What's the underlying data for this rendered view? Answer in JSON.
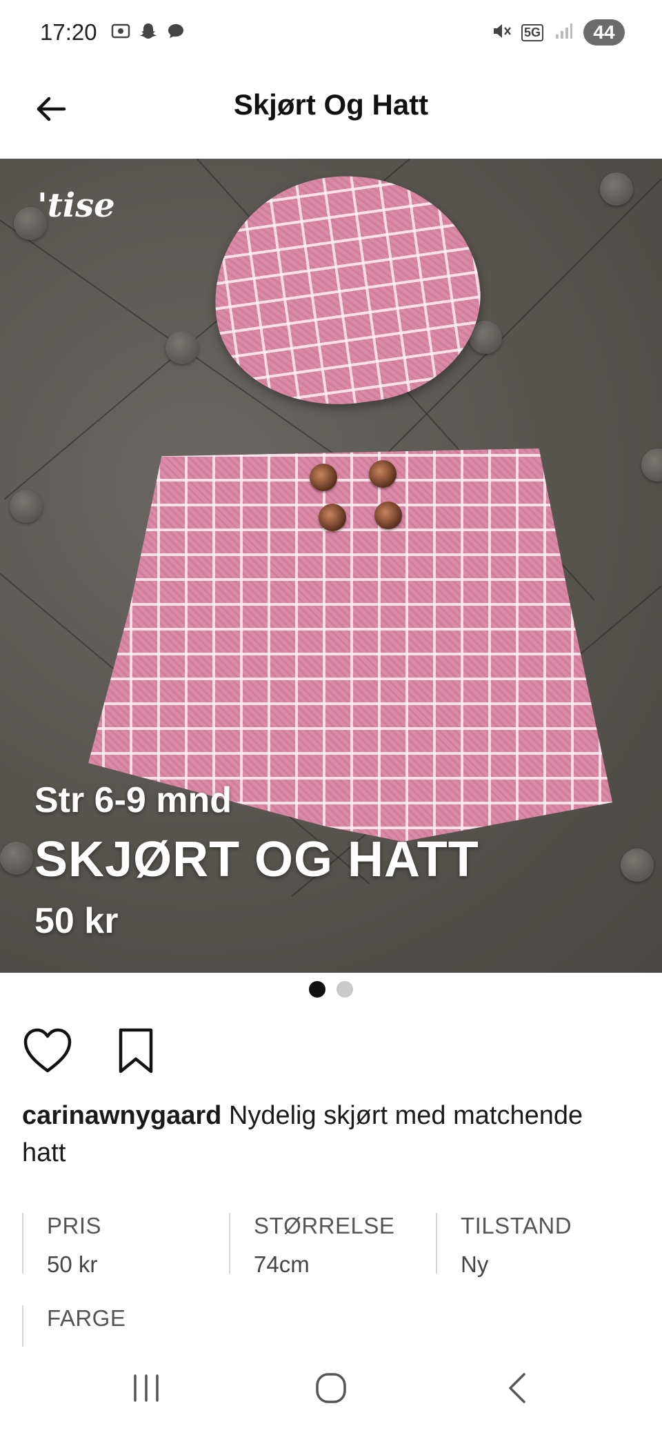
{
  "status_bar": {
    "time": "17:20",
    "network": "5G",
    "battery": "44"
  },
  "header": {
    "title": "Skjørt Og Hatt"
  },
  "image": {
    "brand_logo": "'tise",
    "overlay_size": "Str 6-9 mnd",
    "overlay_title": "SKJØRT OG HATT",
    "overlay_price": "50 kr",
    "page_count": 2,
    "active_page": 1
  },
  "post": {
    "username": "carinawnygaard",
    "description": "Nydelig skjørt med matchende hatt"
  },
  "attributes": [
    {
      "label": "PRIS",
      "value": "50 kr"
    },
    {
      "label": "STØRRELSE",
      "value": "74cm"
    },
    {
      "label": "TILSTAND",
      "value": "Ny"
    }
  ],
  "attributes_second": [
    {
      "label": "FARGE",
      "value": ""
    }
  ],
  "colors": {
    "accent": "#111111",
    "fabric_pink": "#d98aa7",
    "background_fabric": "#57534f"
  },
  "icons": {
    "back": "arrow-left-icon",
    "like": "heart-icon",
    "save": "bookmark-icon",
    "nav_recents": "recents-icon",
    "nav_home": "home-icon",
    "nav_back": "chevron-left-icon"
  }
}
